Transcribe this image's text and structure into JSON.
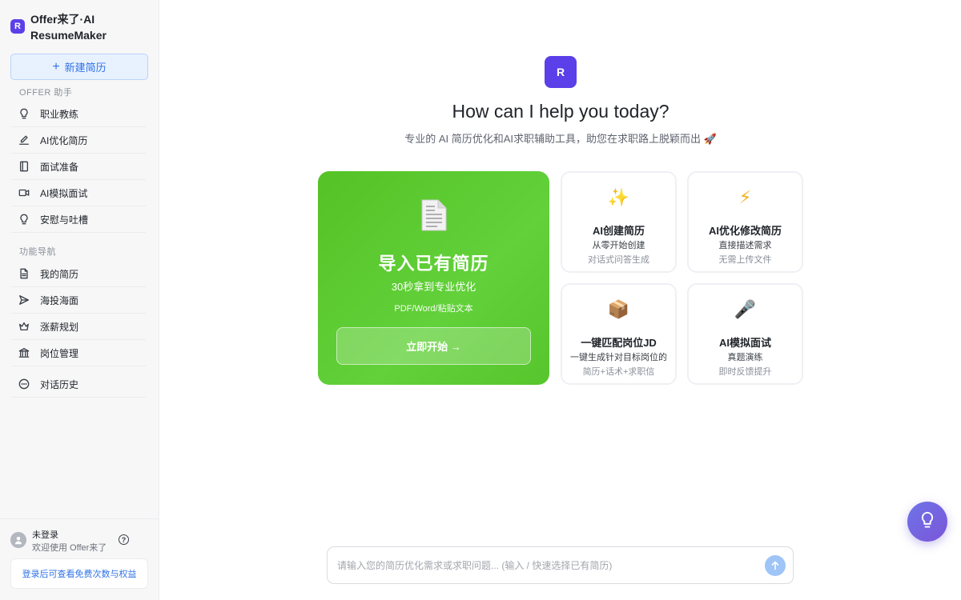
{
  "sidebar": {
    "brand_logo": "R",
    "brand_name": "Offer来了·AI ResumeMaker",
    "new_button": "新建简历",
    "section_assistant": "OFFER 助手",
    "assistant_items": [
      {
        "label": "职业教练",
        "icon": "lightbulb-icon"
      },
      {
        "label": "AI优化简历",
        "icon": "pen-icon"
      },
      {
        "label": "面试准备",
        "icon": "book-icon"
      },
      {
        "label": "AI模拟面试",
        "icon": "video-icon"
      },
      {
        "label": "安慰与吐槽",
        "icon": "lightbulb-icon"
      }
    ],
    "section_nav": "功能导航",
    "nav_items": [
      {
        "label": "我的简历",
        "icon": "document-icon"
      },
      {
        "label": "海投海面",
        "icon": "send-icon"
      },
      {
        "label": "涨薪规划",
        "icon": "crown-icon"
      },
      {
        "label": "岗位管理",
        "icon": "building-icon"
      }
    ],
    "history_item": {
      "label": "对话历史",
      "icon": "chat-icon"
    },
    "user": {
      "name": "未登录",
      "subtitle": "欢迎使用 Offer来了"
    },
    "login_tip": "登录后可查看免费次数与权益"
  },
  "main": {
    "logo": "R",
    "headline": "How can I help you today?",
    "subline": "专业的 AI 简历优化和AI求职辅助工具，助您在求职路上脱颖而出 🚀",
    "hero": {
      "title": "导入已有简历",
      "subtitle": "30秒拿到专业优化",
      "formats": "PDF/Word/粘贴文本",
      "button": "立即开始 →",
      "icon": "document-icon"
    },
    "cards": [
      {
        "icon": "sparkles-icon",
        "glyph": "✨",
        "title": "AI创建简历",
        "line1": "从零开始创建",
        "line2": "对话式问答生成"
      },
      {
        "icon": "lightning-icon",
        "glyph": "⚡",
        "title": "AI优化修改简历",
        "line1": "直接描述需求",
        "line2": "无需上传文件"
      },
      {
        "icon": "package-icon",
        "glyph": "📦",
        "title": "一键匹配岗位JD",
        "line1": "一键生成针对目标岗位的",
        "line2": "简历+话术+求职信"
      },
      {
        "icon": "microphone-icon",
        "glyph": "🎤",
        "title": "AI模拟面试",
        "line1": "真题演练",
        "line2": "即时反馈提升"
      }
    ],
    "input_placeholder": "请输入您的简历优化需求或求职问题... (输入 / 快速选择已有简历)"
  },
  "colors": {
    "brand": "#5b3fe8",
    "hero_green": "#5ac82e",
    "link_blue": "#2f73e8",
    "fab_purple": "#7460e0"
  }
}
